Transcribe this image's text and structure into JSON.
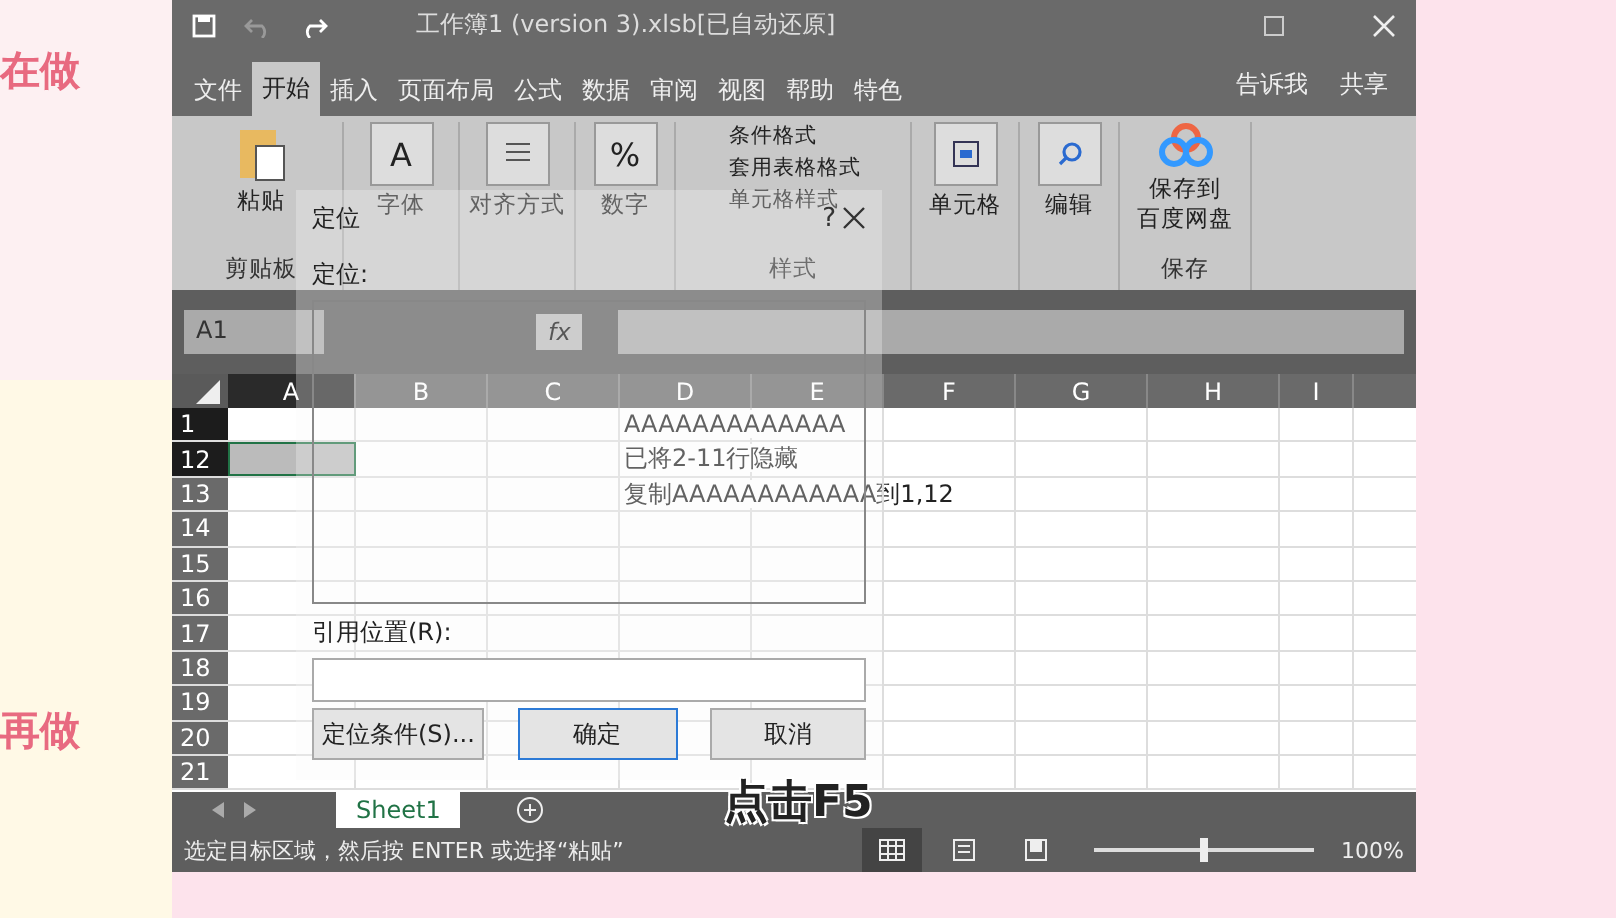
{
  "side_notes": [
    "在做",
    "再做"
  ],
  "window": {
    "title": "工作簿1 (version 3).xlsb[已自动还原]"
  },
  "tabs": [
    {
      "label": "文件",
      "selected": false
    },
    {
      "label": "开始",
      "selected": true
    },
    {
      "label": "插入",
      "selected": false
    },
    {
      "label": "页面布局",
      "selected": false
    },
    {
      "label": "公式",
      "selected": false
    },
    {
      "label": "数据",
      "selected": false
    },
    {
      "label": "审阅",
      "selected": false
    },
    {
      "label": "视图",
      "selected": false
    },
    {
      "label": "帮助",
      "selected": false
    },
    {
      "label": "特色",
      "selected": false
    }
  ],
  "tell_me": "告诉我",
  "share": "共享",
  "ribbon": {
    "paste": "粘贴",
    "clipboard": "剪贴板",
    "font_icon": "A",
    "font": "字体",
    "align": "对齐方式",
    "number_icon": "%",
    "number": "数字",
    "styles": [
      "条件格式",
      "套用表格格式",
      "单元格样式"
    ],
    "styles_group": "样式",
    "cells": "单元格",
    "edit": "编辑",
    "save": [
      "保存到",
      "百度网盘"
    ],
    "save_group": "保存"
  },
  "name_box": "A1",
  "fx": "fx",
  "columns": [
    "A",
    "B",
    "C",
    "D",
    "E",
    "F",
    "G",
    "H",
    "I"
  ],
  "rows": [
    {
      "header": "1",
      "selected": true,
      "d": "AAAAAAAAAAAAA"
    },
    {
      "header": "12",
      "selected": true,
      "d": "已将2-11行隐藏"
    },
    {
      "header": "13",
      "selected": false,
      "d": "复制AAAAAAAAAAAA到1,12"
    },
    {
      "header": "14",
      "selected": false
    },
    {
      "header": "15",
      "selected": false
    },
    {
      "header": "16",
      "selected": false
    },
    {
      "header": "17",
      "selected": false
    },
    {
      "header": "18",
      "selected": false
    },
    {
      "header": "19",
      "selected": false
    },
    {
      "header": "20",
      "selected": false
    },
    {
      "header": "21",
      "selected": false
    }
  ],
  "sheets": [
    {
      "label": "Sheet1",
      "selected": true
    }
  ],
  "status": "选定目标区域，然后按 ENTER 或选择“粘贴”",
  "views": [
    {
      "kind": "normal",
      "selected": true
    },
    {
      "kind": "layout",
      "selected": false
    },
    {
      "kind": "break",
      "selected": false
    }
  ],
  "zoom": {
    "level": 0.5,
    "reading": "100%"
  },
  "dialog": {
    "title": "定位",
    "help": "?",
    "list_label": "定位:",
    "ref_label": "引用位置(R):",
    "buttons": [
      {
        "label": "定位条件(S)...",
        "default": false
      },
      {
        "label": "确定",
        "default": true
      },
      {
        "label": "取消",
        "default": false
      }
    ]
  },
  "caption": "点击F5"
}
